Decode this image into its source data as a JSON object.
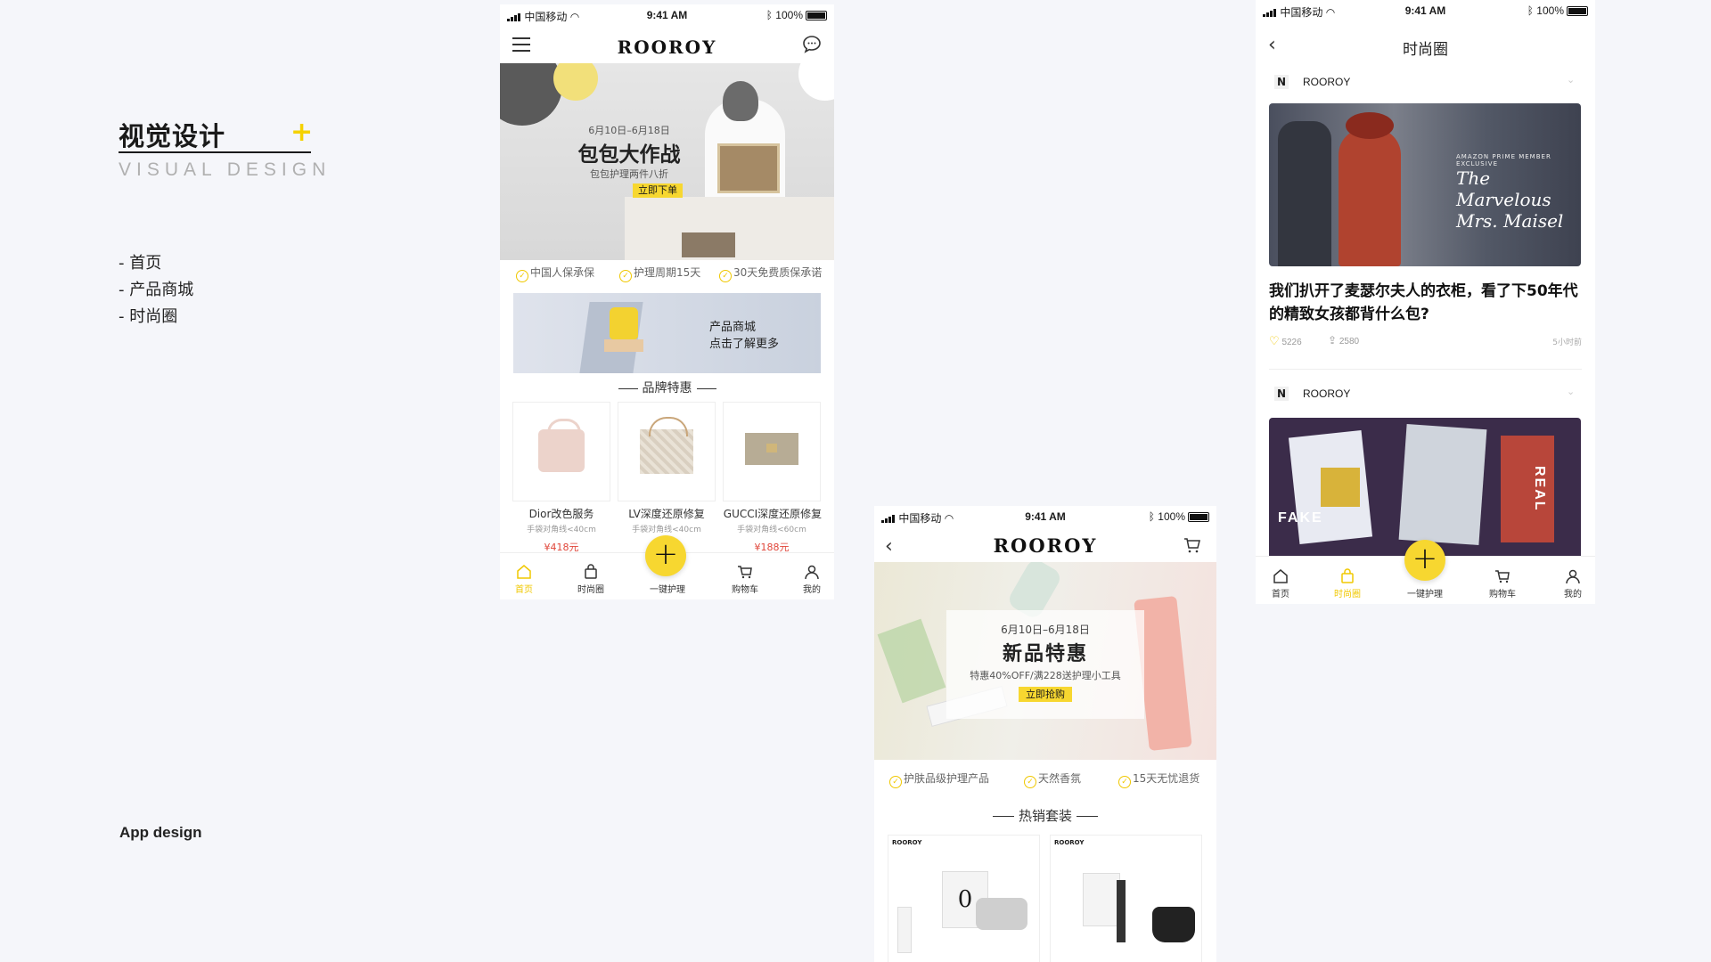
{
  "intro": {
    "title": "视觉设计",
    "plus": "+",
    "subtitle": "VISUAL  DESIGN",
    "menu": [
      "-  首页",
      "-  产品商城",
      "-  时尚圈"
    ],
    "footer": "App design"
  },
  "status": {
    "carrier": "中国移动",
    "time": "9:41 AM",
    "battery": "100%"
  },
  "phone1": {
    "brand": "ROOROY",
    "banner": {
      "date": "6月10日–6月18日",
      "title": "包包大作战",
      "sub": "包包护理两件八折",
      "cta": "立即下单"
    },
    "guarantees": [
      "中国人保承保",
      "护理周期15天",
      "30天免费质保承诺"
    ],
    "promo": {
      "line1": "产品商城",
      "line2": "点击了解更多"
    },
    "section_title": "品牌特惠",
    "products": [
      {
        "name": "Dior改色服务",
        "size": "手袋对角线<40cm",
        "price": "¥418元"
      },
      {
        "name": "LV深度还原修复",
        "size": "手袋对角线<40cm",
        "price": "¥…元"
      },
      {
        "name": "GUCCI深度还原修复",
        "size": "手袋对角线<60cm",
        "price": "¥188元"
      }
    ],
    "tabs": [
      "首页",
      "时尚圈",
      "一键护理",
      "购物车",
      "我的"
    ],
    "active_tab": "首页"
  },
  "phone2": {
    "brand": "ROOROY",
    "banner": {
      "date": "6月10日–6月18日",
      "title": "新品特惠",
      "sub": "特惠40%OFF/满228送护理小工具",
      "cta": "立即抢购"
    },
    "guarantees": [
      "护肤品级护理产品",
      "天然香氛",
      "15天无忧退货"
    ],
    "section_title": "热销套装",
    "kit_brand": "ROOROY"
  },
  "phone3": {
    "title": "时尚圈",
    "posts": [
      {
        "author": "ROOROY",
        "image_text": "The Marvelous Mrs. Maisel",
        "image_banner": "AMAZON PRIME MEMBER EXCLUSIVE",
        "headline": "我们扒开了麦瑟尔夫人的衣柜，看了下50年代的精致女孩都背什么包?",
        "likes": "5226",
        "shares": "2580",
        "time": "5小时前"
      },
      {
        "author": "ROOROY",
        "image_text_1": "FAKE",
        "image_text_2": "REAL"
      }
    ],
    "tabs": [
      "首页",
      "时尚圈",
      "一键护理",
      "购物车",
      "我的"
    ],
    "active_tab": "时尚圈"
  },
  "colors": {
    "accent": "#f7d730",
    "price": "#e0463a",
    "background": "#f5f6fa"
  }
}
